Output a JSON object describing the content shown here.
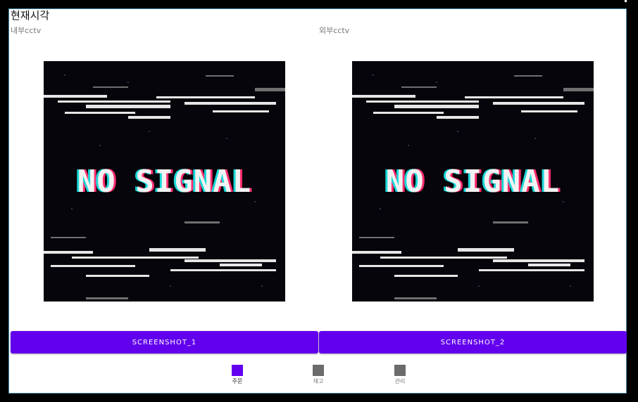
{
  "header": {
    "title": "현재시각"
  },
  "cameras": [
    {
      "label": "내부cctv",
      "feed_text": "NO SIGNAL",
      "button": "SCREENSHOT_1"
    },
    {
      "label": "외부cctv",
      "feed_text": "NO SIGNAL",
      "button": "SCREENSHOT_2"
    }
  ],
  "bottom_nav": {
    "items": [
      {
        "label": "주문",
        "icon": "order-icon",
        "active": true
      },
      {
        "label": "재고",
        "icon": "inventory-icon",
        "active": false
      },
      {
        "label": "관리",
        "icon": "manage-icon",
        "active": false
      }
    ]
  },
  "colors": {
    "accent": "#6200ee",
    "inactive_icon": "#6b6b6b",
    "feed_background": "#05050b",
    "glitch_cyan": "#19d8d8",
    "glitch_pink": "#ff2d6f"
  }
}
